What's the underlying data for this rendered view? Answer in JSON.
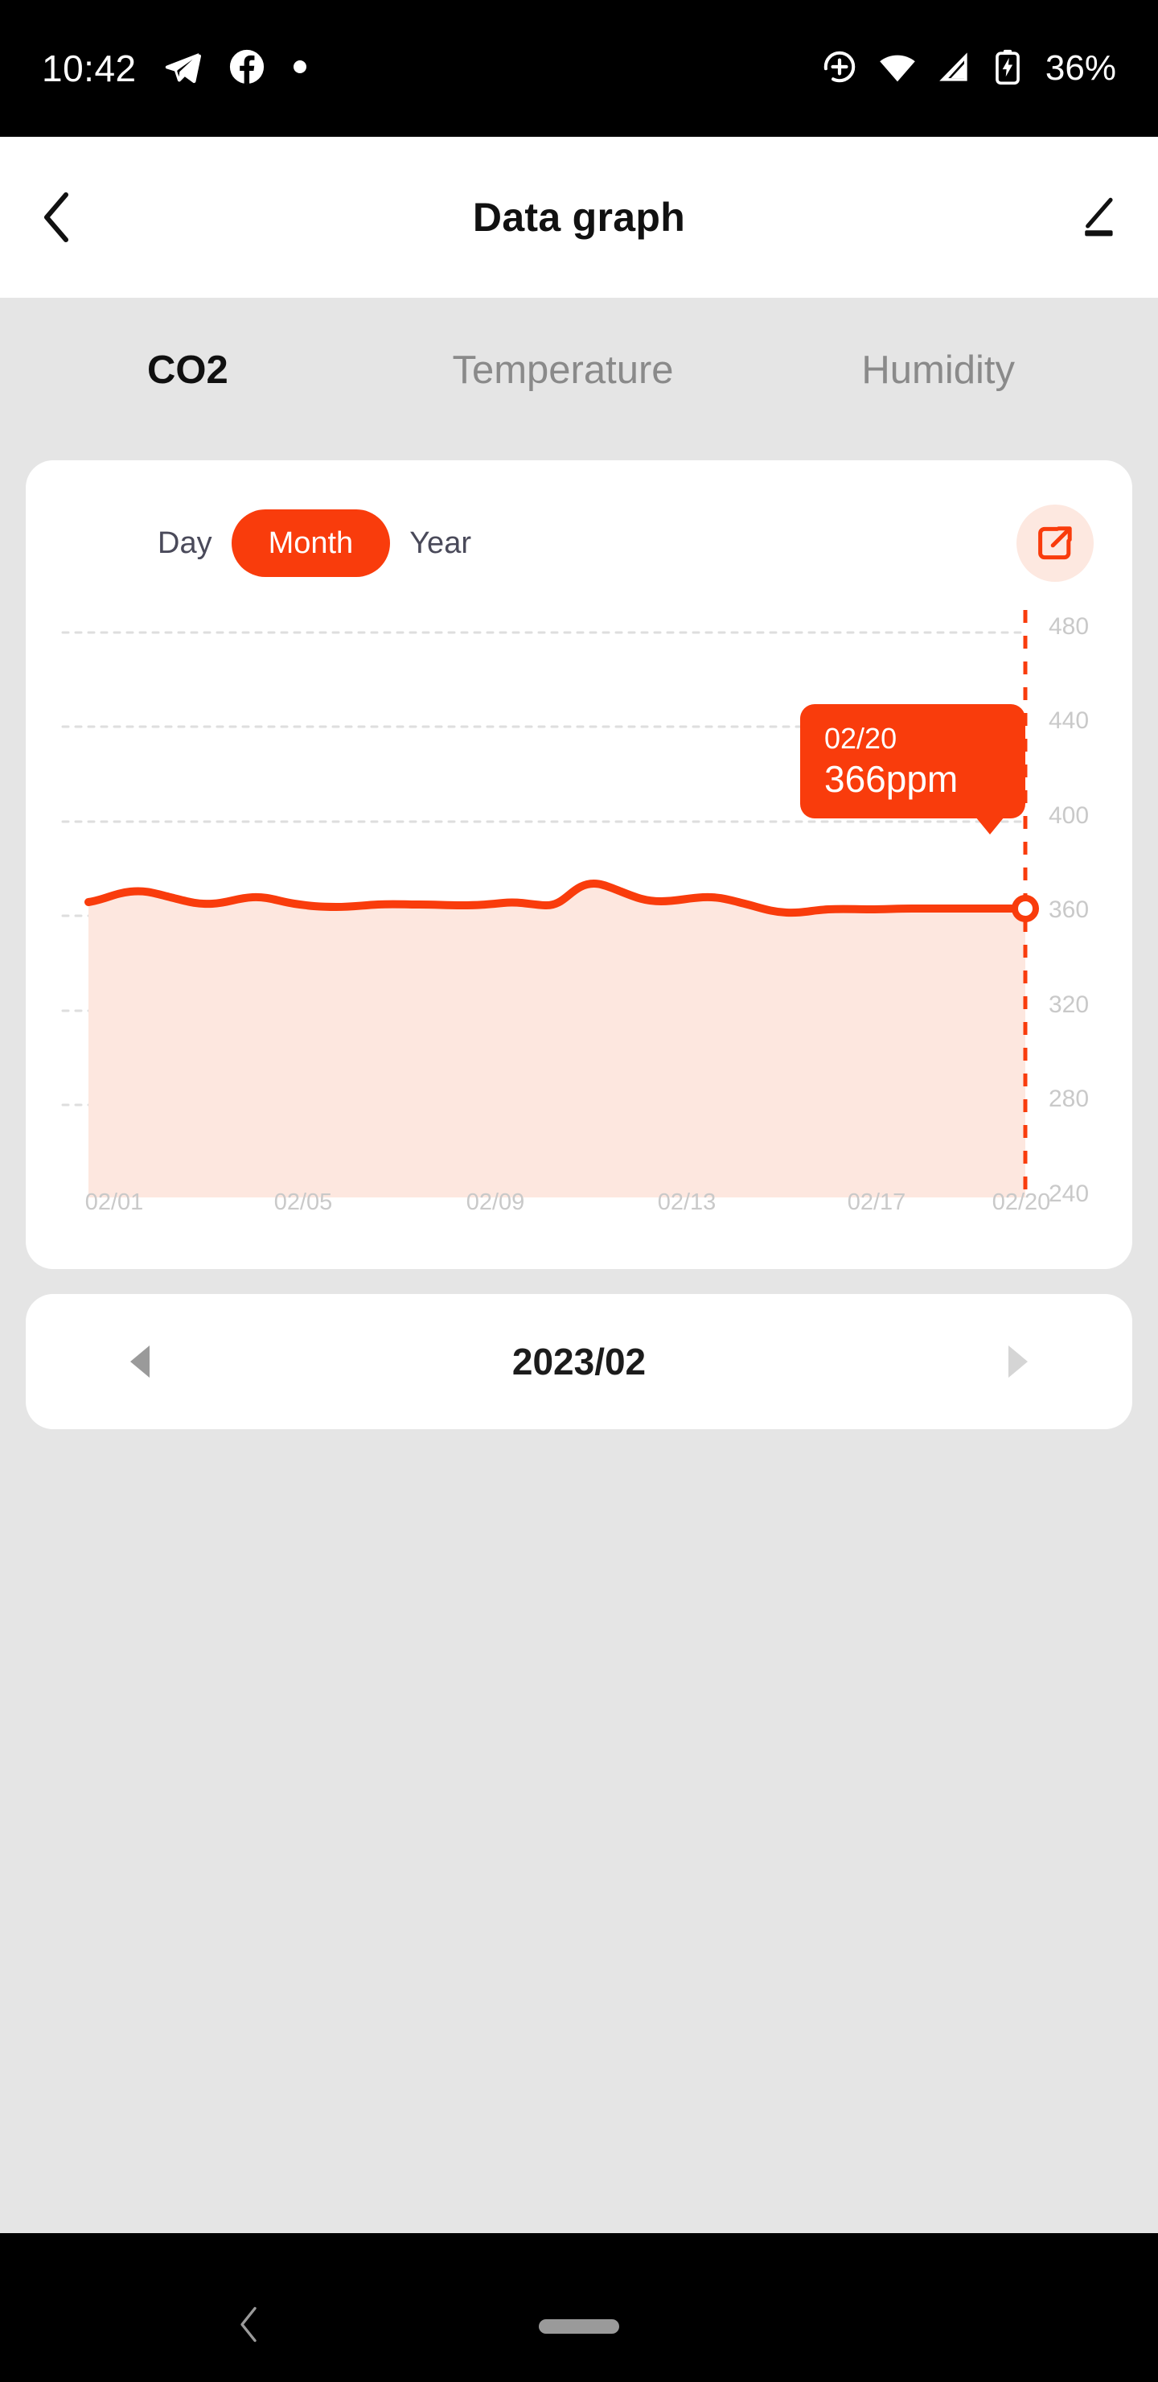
{
  "status_bar": {
    "time": "10:42",
    "battery_percent": "36%",
    "icons": [
      "telegram-icon",
      "facebook-icon",
      "dot-indicator",
      "location-icon",
      "wifi-icon",
      "cellular-signal-icon",
      "battery-charging-icon"
    ]
  },
  "header": {
    "back_label": "back-chevron",
    "title": "Data graph",
    "edit_label": "edit-pencil"
  },
  "tabs": [
    {
      "label": "CO2",
      "active": true
    },
    {
      "label": "Temperature",
      "active": false
    },
    {
      "label": "Humidity",
      "active": false
    }
  ],
  "periods": [
    {
      "label": "Day",
      "active": false
    },
    {
      "label": "Month",
      "active": true
    },
    {
      "label": "Year",
      "active": false
    }
  ],
  "export_button": {
    "icon": "external-link-icon"
  },
  "tooltip": {
    "date": "02/20",
    "value": "366ppm"
  },
  "month_nav": {
    "prev": "prev-month-arrow",
    "label": "2023/02",
    "next": "next-month-arrow"
  },
  "colors": {
    "accent": "#F93C0C",
    "accent_fill": "#FDE6DE",
    "accent_soft_bg": "#FDE8E0",
    "page_bg": "#E5E5E5",
    "card_bg": "#FFFFFF",
    "grid": "#DDDDDD",
    "axis_text": "#C9C9C9"
  },
  "chart_data": {
    "type": "area",
    "title": "CO2",
    "xlabel": "",
    "ylabel": "ppm",
    "unit": "ppm",
    "grid": true,
    "legend": "none",
    "ylim": [
      240,
      480
    ],
    "yticks": [
      480,
      440,
      400,
      360,
      320,
      280,
      240
    ],
    "xticks": [
      "02/01",
      "02/05",
      "02/09",
      "02/13",
      "02/17",
      "02/20"
    ],
    "xtick_positions": [
      1,
      5,
      9,
      13,
      17,
      20
    ],
    "x": [
      "02/01",
      "02/02",
      "02/03",
      "02/04",
      "02/05",
      "02/06",
      "02/07",
      "02/08",
      "02/09",
      "02/10",
      "02/11",
      "02/12",
      "02/13",
      "02/14",
      "02/15",
      "02/16",
      "02/17",
      "02/18",
      "02/19",
      "02/20"
    ],
    "values": [
      368,
      372,
      370,
      366,
      368,
      367,
      365,
      366,
      366,
      366,
      367,
      366,
      372,
      368,
      369,
      368,
      364,
      365,
      366,
      366
    ],
    "selected_index": 19,
    "selected_x": "02/20",
    "selected_y": 366,
    "series": [
      {
        "name": "CO2",
        "values": [
          368,
          372,
          370,
          366,
          368,
          367,
          365,
          366,
          366,
          366,
          367,
          366,
          372,
          368,
          369,
          368,
          364,
          365,
          366,
          366
        ]
      }
    ]
  }
}
